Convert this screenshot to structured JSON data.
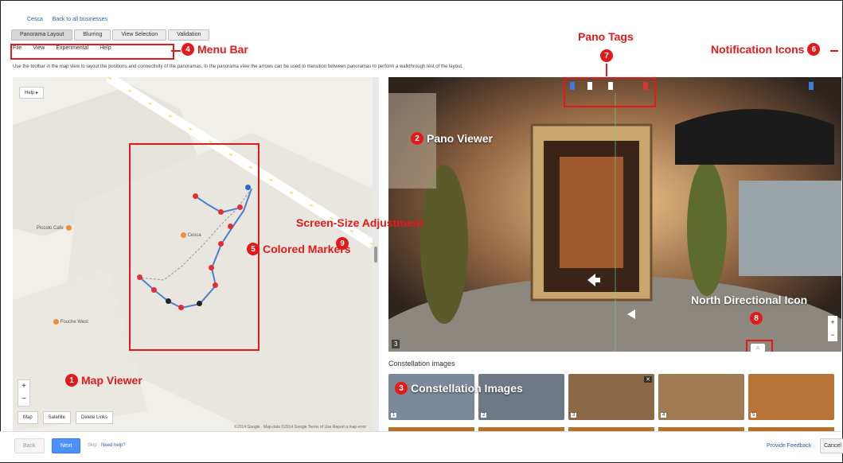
{
  "header": {
    "brand_link": "Cesca",
    "back_link": "Back to all businesses"
  },
  "tabs": [
    {
      "label": "Panorama Layout"
    },
    {
      "label": "Blurring"
    },
    {
      "label": "View Selection"
    },
    {
      "label": "Validation"
    }
  ],
  "menu": [
    "File",
    "View",
    "Experimental",
    "Help"
  ],
  "intro_text": "Use the toolbar in the map view to layout the positions and connectivity of the panoramas. In the panorama view the arrows can be used to transition between panoramas to perform a walkthrough test of the layout.",
  "callouts": {
    "map_viewer": {
      "num": "1",
      "label": "Map Viewer"
    },
    "pano_viewer": {
      "num": "2",
      "label": "Pano Viewer"
    },
    "constellation": {
      "num": "3",
      "label": "Constellation Images"
    },
    "menu_bar": {
      "num": "4",
      "label": "Menu Bar"
    },
    "colored_markers": {
      "num": "5",
      "label": "Colored Markers"
    },
    "notification_icons": {
      "num": "6",
      "label": "Notification Icons"
    },
    "pano_tags": {
      "num": "7",
      "label": "Pano Tags"
    },
    "north_icon": {
      "num": "8",
      "label": "North Directional Icon"
    },
    "screen_size": {
      "num": "9",
      "label": "Screen-Size Adjustment"
    }
  },
  "map": {
    "help_label": "Help ▸",
    "zoom_in": "+",
    "zoom_out": "−",
    "map_button": "Map",
    "satellite_button": "Satellite",
    "delete_links_button": "Delete Links",
    "poi_1": "Piccolo Cafe",
    "poi_2": "Fouche West",
    "poi_3": "Cesca",
    "footer": "©2014 Google · Map data ©2014 Google   Terms of Use   Report a map error"
  },
  "pano": {
    "number": "3",
    "zoom_in": "+",
    "zoom_out": "−"
  },
  "constellation": {
    "label": "Constellation images",
    "thumbs": [
      {
        "num": "1",
        "color": "#7a8a9a"
      },
      {
        "num": "2",
        "color": "#6d7a86"
      },
      {
        "num": "3",
        "color": "#8c6a48"
      },
      {
        "num": "4",
        "color": "#a07a52"
      },
      {
        "num": "5",
        "color": "#b87438"
      }
    ]
  },
  "bottom": {
    "back": "Back",
    "next": "Next",
    "skip": "Skip",
    "need_help": "Need help?",
    "feedback": "Provide Feedback",
    "cancel": "Cancel"
  },
  "colors": {
    "accent_red": "#e21a1a",
    "link_blue": "#2a5db0",
    "primary_button": "#4d90fe"
  }
}
